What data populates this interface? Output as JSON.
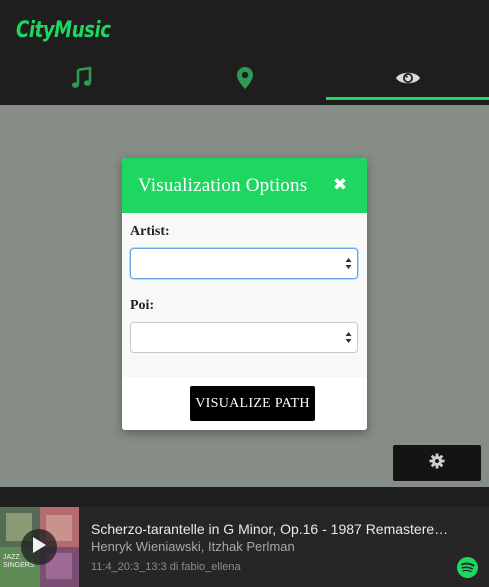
{
  "app": {
    "brand": "CityMusic"
  },
  "tabs": [
    {
      "id": "music",
      "icon": "music-note-icon"
    },
    {
      "id": "poi",
      "icon": "map-marker-icon"
    },
    {
      "id": "visualize",
      "icon": "eye-icon",
      "active": true
    }
  ],
  "colors": {
    "accent": "#1ed760",
    "topbar": "#1e1e1e",
    "map": "#868d86",
    "button": "#000000"
  },
  "modal": {
    "title": "Visualization Options",
    "close_icon": "close-icon",
    "artist_label": "Artist:",
    "artist_value": "",
    "poi_label": "Poi:",
    "poi_value": "",
    "submit_label": "VISUALIZE PATH"
  },
  "settings": {
    "icon": "gear-icon"
  },
  "player": {
    "title": "Scherzo-tarantelle in G Minor, Op.16 - 1987 Remastered ...",
    "artists": "Henryk Wieniawski, Itzhak Perlman",
    "meta": "11:4_20:3_13:3 di fabio_ellena",
    "cover_text": "JAZZ SINGERS",
    "play_icon": "play-icon",
    "service_icon": "spotify-icon"
  }
}
